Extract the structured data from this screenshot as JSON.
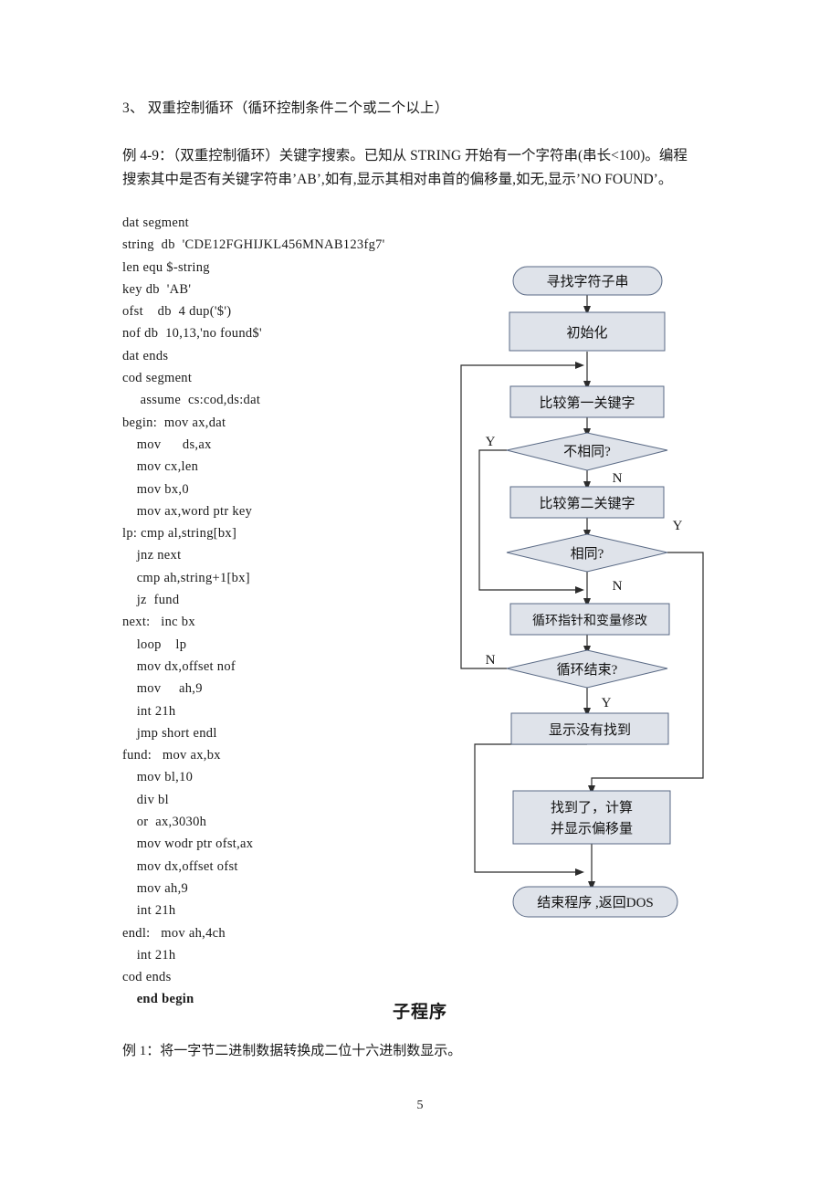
{
  "document": {
    "heading": "3、 双重控制循环（循环控制条件二个或二个以上）",
    "intro_line1": "例 4-9：（双重控制循环）关键字搜索。已知从 STRING 开始有一个字符串(串长<100)。编程",
    "intro_line2": "搜索其中是否有关键字符串’AB’,如有,显示其相对串首的偏移量,如无,显示’NO FOUND’。",
    "figure_caption": "子程序",
    "tail_note": "例 1：将一字节二进制数据转换成二位十六进制数显示。",
    "page_number": "5"
  },
  "code_listing": [
    "dat segment",
    "string  db  'CDE12FGHIJKL456MNAB123fg7'",
    "len equ $-string",
    "key db  'AB'",
    "ofst    db  4 dup('$')",
    "nof db  10,13,'no found$'",
    "dat ends",
    "cod segment",
    "     assume  cs:cod,ds:dat",
    "begin:  mov ax,dat",
    "    mov      ds,ax",
    "    mov cx,len",
    "    mov bx,0",
    "    mov ax,word ptr key",
    "lp: cmp al,string[bx]",
    "    jnz next",
    "    cmp ah,string+1[bx]",
    "    jz  fund",
    "next:   inc bx",
    "    loop    lp",
    "    mov dx,offset nof",
    "    mov     ah,9",
    "    int 21h",
    "    jmp short endl",
    "fund:   mov ax,bx",
    "    mov bl,10",
    "    div bl",
    "    or  ax,3030h",
    "    mov wodr ptr ofst,ax",
    "    mov dx,offset ofst",
    "    mov ah,9",
    "    int 21h",
    "endl:   mov ah,4ch",
    "    int 21h",
    "cod ends",
    "    end begin"
  ],
  "flowchart": {
    "colors": {
      "shape_fill": "#dfe3ea",
      "shape_stroke": "#5a6a85",
      "line": "#2b2b2b",
      "text": "#111111"
    },
    "nodes": [
      {
        "id": "start",
        "type": "terminator",
        "label": "寻找字符子串"
      },
      {
        "id": "init",
        "type": "process",
        "label": "初始化"
      },
      {
        "id": "cmp1",
        "type": "process",
        "label": "比较第一关键字"
      },
      {
        "id": "diff",
        "type": "decision",
        "label": "不相同?"
      },
      {
        "id": "cmp2",
        "type": "process",
        "label": "比较第二关键字"
      },
      {
        "id": "same",
        "type": "decision",
        "label": "相同?"
      },
      {
        "id": "update",
        "type": "process",
        "label": "循环指针和变量修改"
      },
      {
        "id": "loopend",
        "type": "decision",
        "label": "循环结束?"
      },
      {
        "id": "notfound",
        "type": "process",
        "label": "显示没有找到"
      },
      {
        "id": "found",
        "type": "process",
        "label_line1": "找到了，计算",
        "label_line2": "并显示偏移量"
      },
      {
        "id": "end",
        "type": "terminator",
        "label": "结束程序 ,返回DOS"
      }
    ],
    "branch_labels": {
      "diff_yes": "Y",
      "diff_no": "N",
      "same_yes": "Y",
      "same_no": "N",
      "loopend_no": "N",
      "loopend_yes": "Y"
    }
  }
}
